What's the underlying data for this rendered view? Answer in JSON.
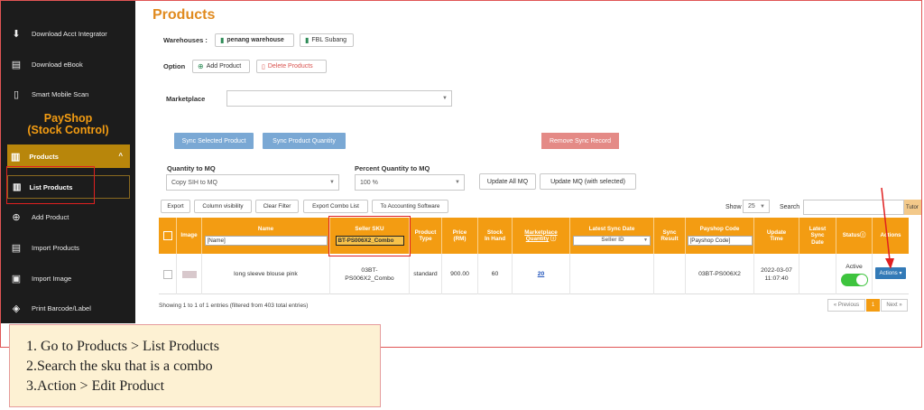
{
  "sidebar": {
    "items_top": [
      {
        "label": "Download Acct Integrator",
        "icon": "download-icon"
      },
      {
        "label": "Download eBook",
        "icon": "book-icon"
      },
      {
        "label": "Smart Mobile Scan",
        "icon": "mobile-icon"
      }
    ],
    "brand_line1": "PayShop",
    "brand_line2": "(Stock Control)",
    "products_label": "Products",
    "list_products_label": "List Products",
    "items_bottom": [
      {
        "label": "Add Product",
        "icon": "plus-circle-icon"
      },
      {
        "label": "Import Products",
        "icon": "import-icon"
      },
      {
        "label": "Import Image",
        "icon": "image-icon"
      },
      {
        "label": "Print Barcode/Label",
        "icon": "tag-icon"
      }
    ]
  },
  "page": {
    "title": "Products",
    "warehouses_label": "Warehouses :",
    "warehouses": [
      "penang warehouse",
      "FBL Subang"
    ],
    "option_label": "Option",
    "add_product": "Add Product",
    "delete_products": "Delete Products",
    "marketplace_label": "Marketplace",
    "sync_selected": "Sync Selected Product",
    "sync_quantity": "Sync Product Quantity",
    "remove_sync": "Remove Sync Record",
    "qty_to_mq_label": "Quantity to MQ",
    "qty_to_mq_value": "Copy SIH to MQ",
    "pct_qty_label": "Percent Quantity to MQ",
    "pct_qty_value": "100 %",
    "update_all_mq": "Update All MQ",
    "update_mq_selected": "Update MQ (with selected)"
  },
  "toolbar": {
    "export": "Export",
    "column_visibility": "Column visibility",
    "clear_filter": "Clear Filter",
    "export_combo": "Export Combo List",
    "to_accounting": "To Accounting Software",
    "show_label": "Show",
    "show_value": "25",
    "search_label": "Search",
    "tutorial": "Tutor"
  },
  "table": {
    "headers": {
      "image": "Image",
      "name": "Name",
      "name_filter": "[Name]",
      "seller_sku": "Seller SKU",
      "seller_sku_filter": "BT-PS006X2_Combo",
      "product_type_1": "Product",
      "product_type_2": "Type",
      "price_1": "Price",
      "price_2": "(RM)",
      "stock_1": "Stock",
      "stock_2": "In Hand",
      "mq_1": "Marketplace",
      "mq_2": "Quantity",
      "latest_sync_date": "Latest Sync Date",
      "seller_id_filter": "Seller ID",
      "sync_result_1": "Sync",
      "sync_result_2": "Result",
      "payshop_code": "Payshop Code",
      "payshop_code_filter": "[Payshop Code]",
      "update_time_1": "Update",
      "update_time_2": "Time",
      "latest_sync_1": "Latest",
      "latest_sync_2": "Sync",
      "latest_sync_3": "Date",
      "status": "Status",
      "actions": "Actions"
    },
    "row": {
      "name": "long sleeve blouse pink",
      "sku_1": "03BT-",
      "sku_2": "PS006X2_Combo",
      "product_type": "standard",
      "price": "900.00",
      "stock": "60",
      "mq": "20",
      "payshop_code": "03BT-PS006X2",
      "update_date": "2022-03-07",
      "update_time": "11:07:40",
      "status": "Active",
      "actions": "Actions"
    },
    "info": "Showing 1 to 1 of 1 entries (filtered from 403 total entries)",
    "pager": {
      "previous": "« Previous",
      "current": "1",
      "next": "Next »"
    }
  },
  "notes": [
    "1. Go to Products > List Products",
    "2.Search the sku that is a combo",
    "3.Action > Edit Product"
  ],
  "colors": {
    "accent": "#f39c12",
    "title": "#e08a1e",
    "annotation": "#e02020"
  }
}
